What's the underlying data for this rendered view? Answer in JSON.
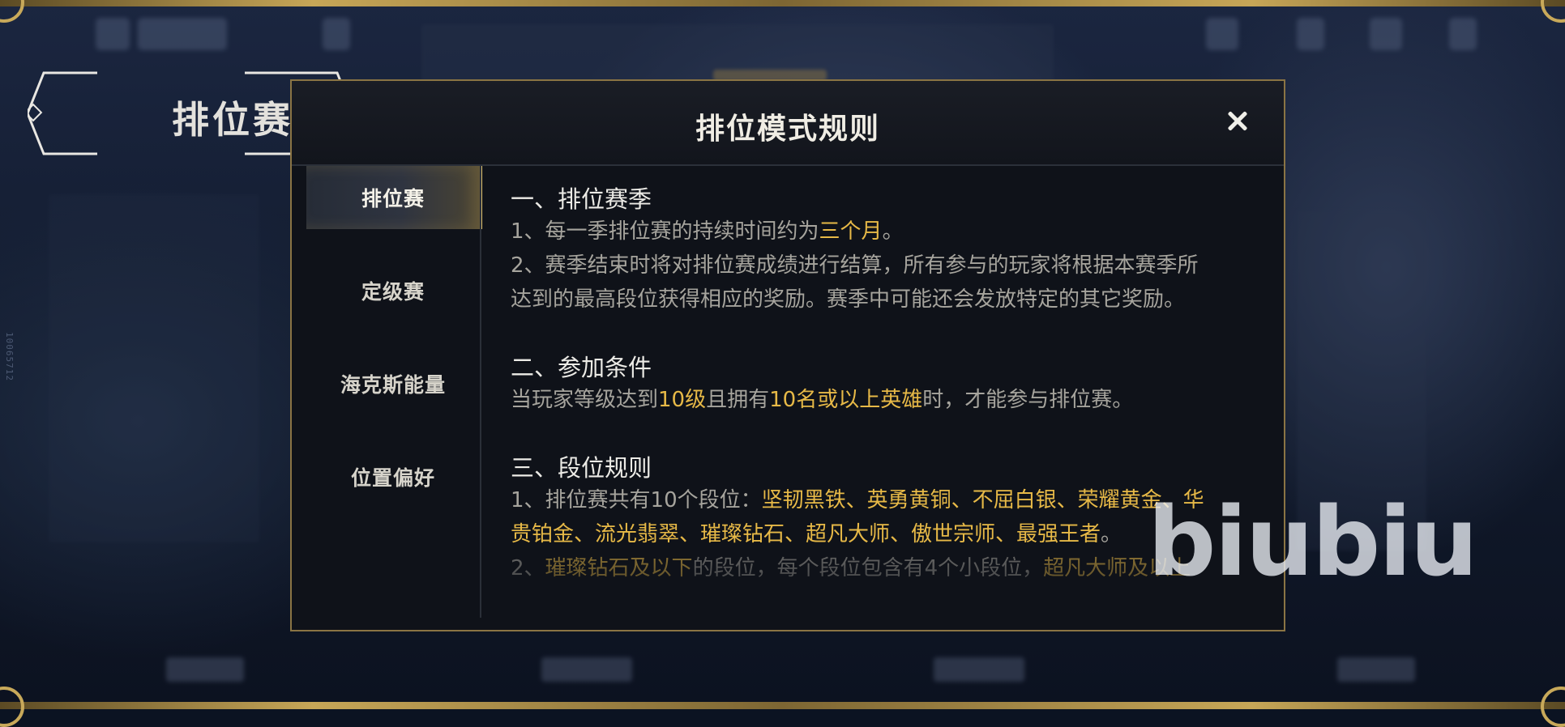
{
  "modal": {
    "title": "排位模式规则",
    "close_icon": "close-icon"
  },
  "plaque": {
    "title": "排位赛"
  },
  "tabs": [
    {
      "label": "排位赛",
      "active": true
    },
    {
      "label": "定级赛",
      "active": false
    },
    {
      "label": "海克斯能量",
      "active": false
    },
    {
      "label": "位置偏好",
      "active": false
    }
  ],
  "content": {
    "s1_title": "一、排位赛季",
    "s1_l1_a": "1、每一季排位赛的持续时间约为",
    "s1_l1_hl": "三个月",
    "s1_l1_b": "。",
    "s1_l2a": "2、赛季结束时将对排位赛成绩进行结算，所有参与的玩家将根据本赛季所",
    "s1_l2b": "达到的最高段位获得相应的奖励。赛季中可能还会发放特定的其它奖励。",
    "s2_title": "二、参加条件",
    "s2_a": "当玩家等级达到",
    "s2_hl1": "10级",
    "s2_b": "且拥有",
    "s2_hl2": "10名或以上英雄",
    "s2_c": "时，才能参与排位赛。",
    "s3_title": "三、段位规则",
    "s3_l1_a": "1、排位赛共有10个段位：",
    "s3_l1_hl": "坚韧黑铁、英勇黄铜、不屈白银、荣耀黄金、华",
    "s3_l2_hl": "贵铂金、流光翡翠、璀璨钻石、超凡大师、傲世宗师、最强王者",
    "s3_l2_b": "。",
    "s3_l3_a": "2、",
    "s3_l3_hl1": "璀璨钻石及以下",
    "s3_l3_b": "的段位，每个段位包含有4个小段位，",
    "s3_l3_hl2": "超凡大师及以上"
  },
  "watermark": "biubiu",
  "side_id": "10065712",
  "colors": {
    "accent": "#e7b947",
    "frame_gold": "#c8a95a",
    "modal_bg": "#0f1219"
  }
}
